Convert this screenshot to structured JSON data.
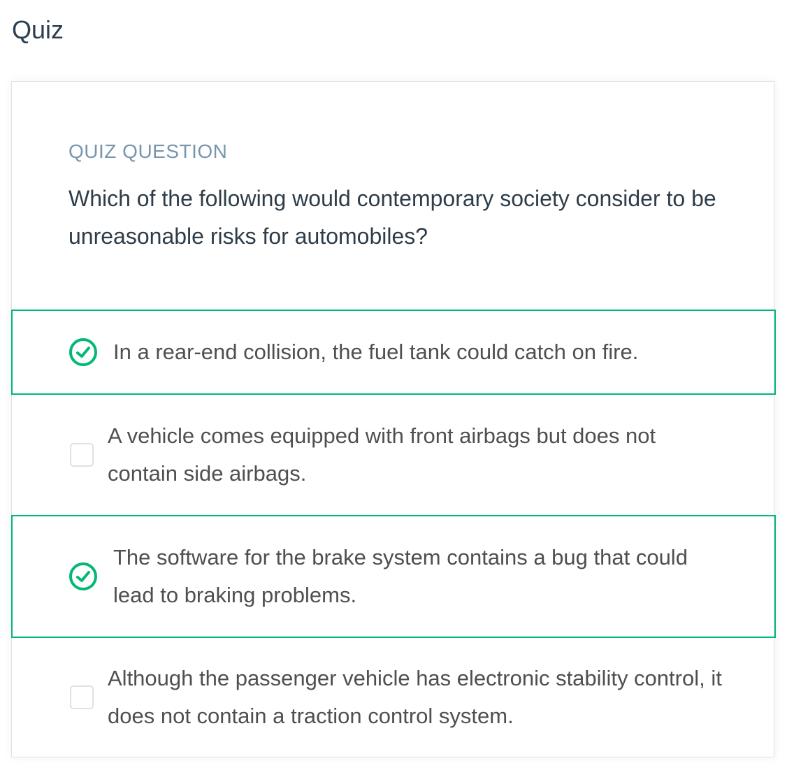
{
  "header": {
    "title": "Quiz"
  },
  "quiz": {
    "label": "QUIZ QUESTION",
    "question": "Which of the following would contemporary society consider to be unreasonable risks for automobiles?",
    "options": [
      {
        "text": "In a rear-end collision, the fuel tank could catch on fire.",
        "selected": true
      },
      {
        "text": "A vehicle comes equipped with front airbags but does not contain side airbags.",
        "selected": false
      },
      {
        "text": "The software for the brake system contains a bug that could lead to braking problems.",
        "selected": true
      },
      {
        "text": "Although the passenger vehicle has electronic stability control, it does not contain a traction control system.",
        "selected": false
      }
    ]
  },
  "colors": {
    "accent": "#02b875"
  }
}
